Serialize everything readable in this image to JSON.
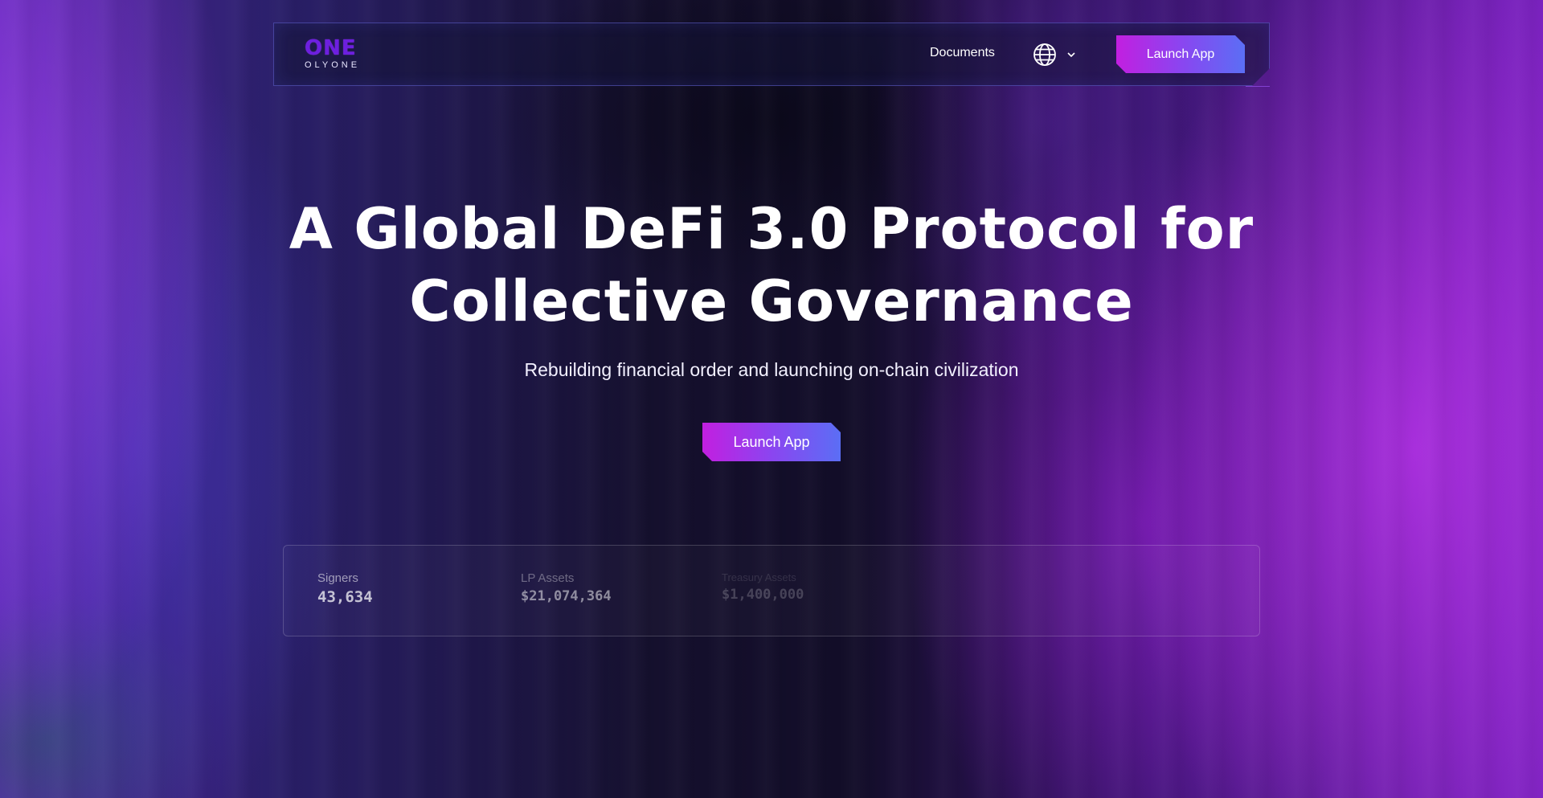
{
  "header": {
    "logo_mark": "ONE",
    "logo_text": "OLYONE",
    "nav_documents": "Documents",
    "language_icon": "globe-icon",
    "language_chevron_icon": "chevron-down-icon",
    "launch_label": "Launch App"
  },
  "hero": {
    "title_line1": "A Global DeFi 3.0 Protocol for",
    "title_line2": "Collective Governance",
    "subtitle": "Rebuilding financial order and launching on-chain civilization",
    "cta_label": "Launch App"
  },
  "stats": [
    {
      "label": "Signers",
      "value": "43,634"
    },
    {
      "label": "LP Assets",
      "value": "$21,074,364"
    },
    {
      "label": "Treasury Assets",
      "value": "$1,400,000"
    }
  ],
  "colors": {
    "accent_start": "#c21fe0",
    "accent_end": "#5b6ef5",
    "logo": "#6d1fe0"
  }
}
